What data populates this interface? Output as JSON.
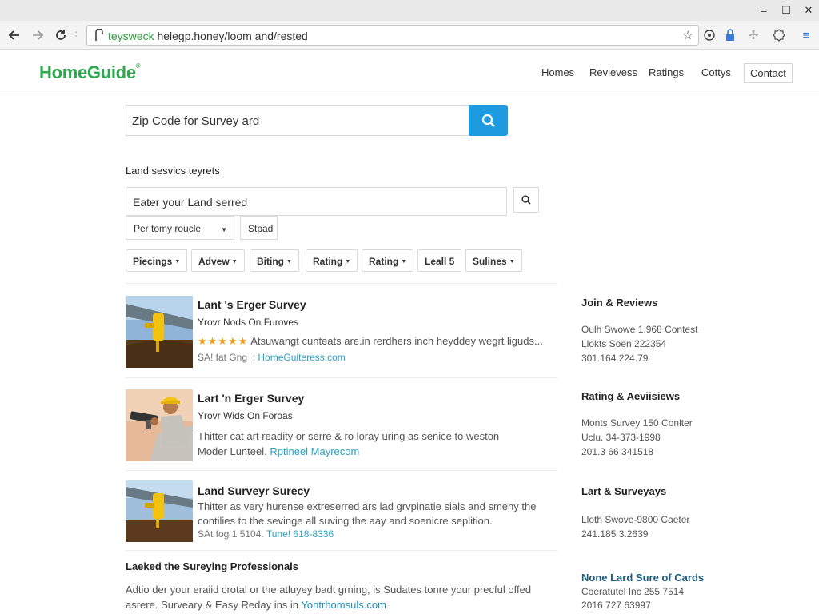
{
  "browser": {
    "url_secure": "teysweck",
    "url_rest": " helegp.honey/loom and/rested",
    "window_controls": [
      "–",
      "☐",
      "✕"
    ]
  },
  "site": {
    "logo": "HomeGuide",
    "nav": [
      "Homes",
      "Revievess",
      "Ratings",
      "Cottys",
      "Contact"
    ]
  },
  "search": {
    "main_placeholder": "Zip Code for Survey ard",
    "section_label": "Land sesvics teyrets",
    "land_placeholder": "Eater your Land serred",
    "dropdown1": "Per tomy roucle",
    "dropdown2": "Stpad",
    "chips": [
      "Piecings",
      "Advew",
      "Biting",
      "Rating",
      "Rating",
      "Leall 5",
      "Sulines"
    ]
  },
  "listings": [
    {
      "title": "Lant 's Erger Survey",
      "sub": "Yrovr Nods On Furoves",
      "stars": "★★★★★",
      "desc": "Atsuwangt cunteats are.in rerdhers inch heyddey wegrt liguds...",
      "meta": "SA! fat Gng",
      "link": "HomeGuiteress.com"
    },
    {
      "title": "Lart 'n Erger Survey",
      "sub": "Yrovr Wids On Foroas",
      "desc": "Thitter cat art readity or serre & ro loray uring as senice to weston",
      "meta": "Moder Lunteel.",
      "link": "Rptineel Mayrecom"
    },
    {
      "title": "Land Surveyr Surecy",
      "desc": "Thitter as very hurense extreserred ars lad grvpinatie sials and smeny the",
      "desc2": "contilies to the sevinge all suving the aay and soenicre seplition.",
      "meta": "SAt fog 1 5104.",
      "link": "Tune! 618-8336"
    }
  ],
  "bottom": {
    "title": "Laeked the Sureying Professionals",
    "line1": "Adtio der your eraiid crotal or the atluyey badt grning, is Sudates tonre your precful offed",
    "line2_prefix": "asrere.  Surveary & Easy Reday ins in",
    "line2_link": "Yontrhomsuls.com"
  },
  "sidebar": [
    {
      "head": "Join & Reviews",
      "lines": [
        "Oulh Swowe 1.968 Contest",
        "Llokts Soen 222354",
        "301.164.224.79"
      ]
    },
    {
      "head": "Rating & Aeviisiews",
      "lines": [
        "Monts Survey 150 Conlter",
        "Uclu. 34-373-1998",
        "201.3 66 341518"
      ]
    },
    {
      "head": "Lart & Surveyays",
      "lines": [
        "Lloth Swove-9800 Caeter",
        "241.185 3.2639"
      ]
    },
    {
      "head": "None Lard Sure of Cards",
      "lines": [
        "Coeratutel Inc 255 7514",
        "2016 727 63997"
      ]
    }
  ],
  "colors": {
    "logo_green": "#2fa84f",
    "search_blue": "#1e9be0",
    "link_blue": "#2aa1c8",
    "star_orange": "#f39c12"
  }
}
